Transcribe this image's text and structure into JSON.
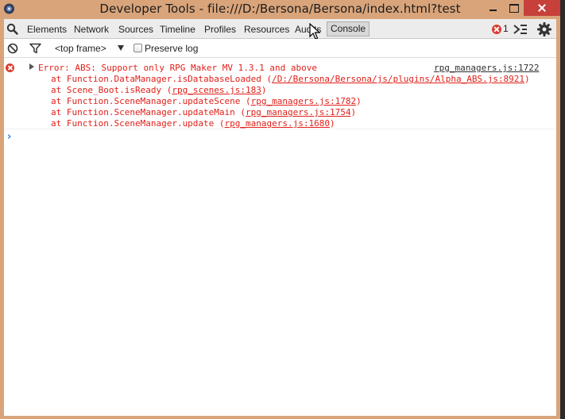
{
  "window": {
    "title": "Developer Tools - file:///D:/Bersona/Bersona/index.html?test"
  },
  "toolbar": {
    "tabs": [
      {
        "label": "Elements"
      },
      {
        "label": "Network"
      },
      {
        "label": "Sources"
      },
      {
        "label": "Timeline"
      },
      {
        "label": "Profiles"
      },
      {
        "label": "Resources"
      },
      {
        "label": "Audits"
      }
    ],
    "active_tab": "Console",
    "error_count": "1"
  },
  "filterbar": {
    "frame": "<top frame>",
    "preserve_log_label": "Preserve log",
    "preserve_log_checked": false
  },
  "console": {
    "error": {
      "message": "Error: ABS: Support only RPG Maker MV 1.3.1 and above",
      "source": "rpg_managers.js:1722",
      "stack": [
        {
          "prefix": "at Function.DataManager.isDatabaseLoaded (",
          "link": "/D:/Bersona/Bersona/js/plugins/Alpha_ABS.js:8921",
          "suffix": ")"
        },
        {
          "prefix": "at Scene_Boot.isReady (",
          "link": "rpg_scenes.js:183",
          "suffix": ")"
        },
        {
          "prefix": "at Function.SceneManager.updateScene (",
          "link": "rpg_managers.js:1782",
          "suffix": ")"
        },
        {
          "prefix": "at Function.SceneManager.updateMain (",
          "link": "rpg_managers.js:1754",
          "suffix": ")"
        },
        {
          "prefix": "at Function.SceneManager.update (",
          "link": "rpg_managers.js:1680",
          "suffix": ")"
        }
      ]
    },
    "prompt": "›"
  },
  "colors": {
    "title_bar": "#d9a47a",
    "error_red": "#e0201a",
    "close_button": "#c7403a",
    "prompt_blue": "#2a7ae2"
  }
}
